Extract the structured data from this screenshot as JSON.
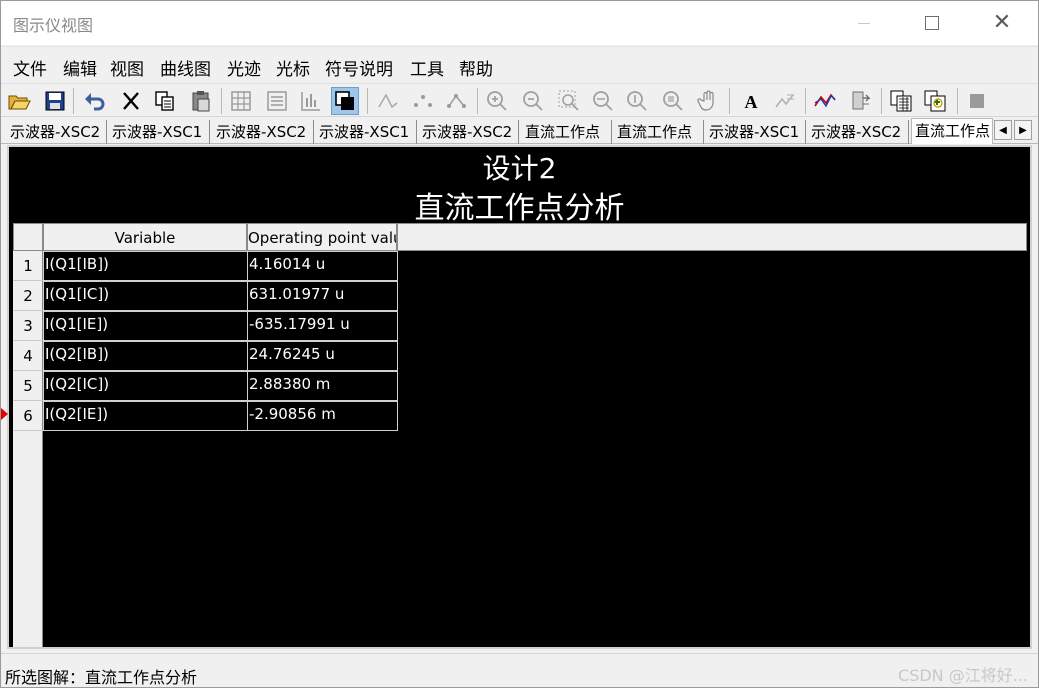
{
  "window": {
    "title": "图示仪视图"
  },
  "menu": [
    "文件",
    "编辑",
    "视图",
    "曲线图",
    "光迹",
    "光标",
    "符号说明",
    "工具",
    "帮助"
  ],
  "toolbar": {
    "icons": [
      "open-folder-icon",
      "save-icon",
      "undo-icon",
      "cut-icon",
      "copy-icon",
      "paste-icon",
      "grid-icon",
      "list-icon",
      "chart-bars-icon",
      "overlay-icon",
      "trace-peak-icon",
      "trace-dots-icon",
      "trace-markers-icon",
      "zoom-in-icon",
      "zoom-out-icon",
      "zoom-fit-icon",
      "zoom-x-icon",
      "zoom-y-icon",
      "zoom-area-icon",
      "pan-hand-icon",
      "text-icon",
      "legend-icon",
      "cursor-icon",
      "export-icon",
      "copy-page-icon",
      "replace-page-icon",
      "stop-icon"
    ]
  },
  "tabs": [
    "示波器-XSC2",
    "示波器-XSC1",
    "示波器-XSC2",
    "示波器-XSC1",
    "示波器-XSC2",
    "直流工作点",
    "直流工作点",
    "示波器-XSC1",
    "示波器-XSC2",
    "直流工作点"
  ],
  "active_tab_index": 9,
  "plot": {
    "title": "设计2",
    "subtitle": "直流工作点分析",
    "columns": [
      "Variable",
      "Operating point value"
    ],
    "rows": [
      {
        "num": "1",
        "variable": "I(Q1[IB])",
        "value": "4.16014 u"
      },
      {
        "num": "2",
        "variable": "I(Q1[IC])",
        "value": "631.01977 u"
      },
      {
        "num": "3",
        "variable": "I(Q1[IE])",
        "value": "-635.17991 u"
      },
      {
        "num": "4",
        "variable": "I(Q2[IB])",
        "value": "24.76245 u"
      },
      {
        "num": "5",
        "variable": "I(Q2[IC])",
        "value": "2.88380 m"
      },
      {
        "num": "6",
        "variable": "I(Q2[IE])",
        "value": "-2.90856 m"
      }
    ]
  },
  "status": {
    "selected": "所选图解：直流工作点分析",
    "watermark": "CSDN @江将好..."
  }
}
